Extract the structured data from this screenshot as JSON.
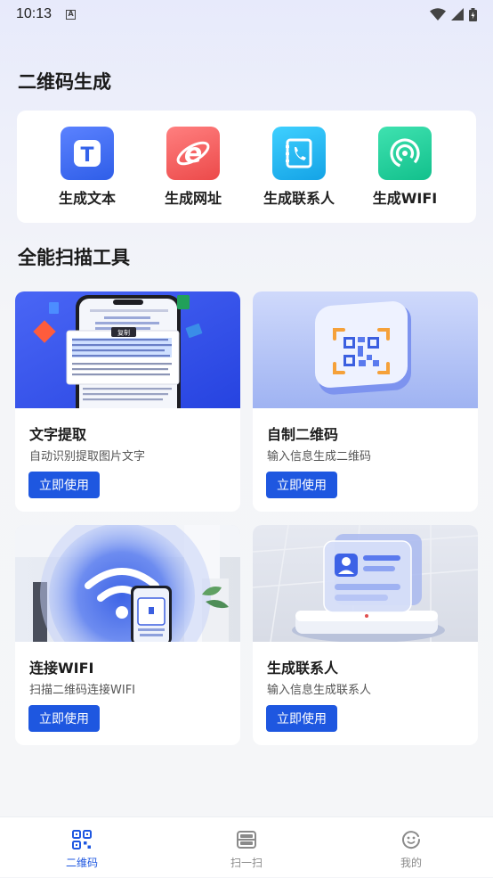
{
  "status_bar": {
    "time": "10:13",
    "notif_letter": "A"
  },
  "generate": {
    "title": "二维码生成",
    "items": [
      {
        "label": "生成文本",
        "icon": "text-icon",
        "color": "#3f6bf0",
        "glyph": "T"
      },
      {
        "label": "生成网址",
        "icon": "browser-e-icon",
        "color": "#f05b5b",
        "glyph": "e"
      },
      {
        "label": "生成联系人",
        "icon": "contacts-phone-icon",
        "color": "#1fb4ee"
      },
      {
        "label": "生成WIFI",
        "icon": "wifi-signal-icon",
        "color": "#1ccf9a"
      }
    ]
  },
  "tools": {
    "title": "全能扫描工具",
    "cards": [
      {
        "title": "文字提取",
        "desc": "自动识别提取图片文字",
        "button": "立即使用",
        "copy_tag": "复制"
      },
      {
        "title": "自制二维码",
        "desc": "输入信息生成二维码",
        "button": "立即使用"
      },
      {
        "title": "连接WIFI",
        "desc": "扫描二维码连接WIFI",
        "button": "立即使用"
      },
      {
        "title": "生成联系人",
        "desc": "输入信息生成联系人",
        "button": "立即使用"
      }
    ]
  },
  "tabbar": {
    "tabs": [
      {
        "label": "二维码",
        "icon": "qrcode-icon",
        "active": true
      },
      {
        "label": "扫一扫",
        "icon": "scan-icon",
        "active": false
      },
      {
        "label": "我的",
        "icon": "smiley-icon",
        "active": false
      }
    ],
    "active_color": "#1e57e0"
  }
}
